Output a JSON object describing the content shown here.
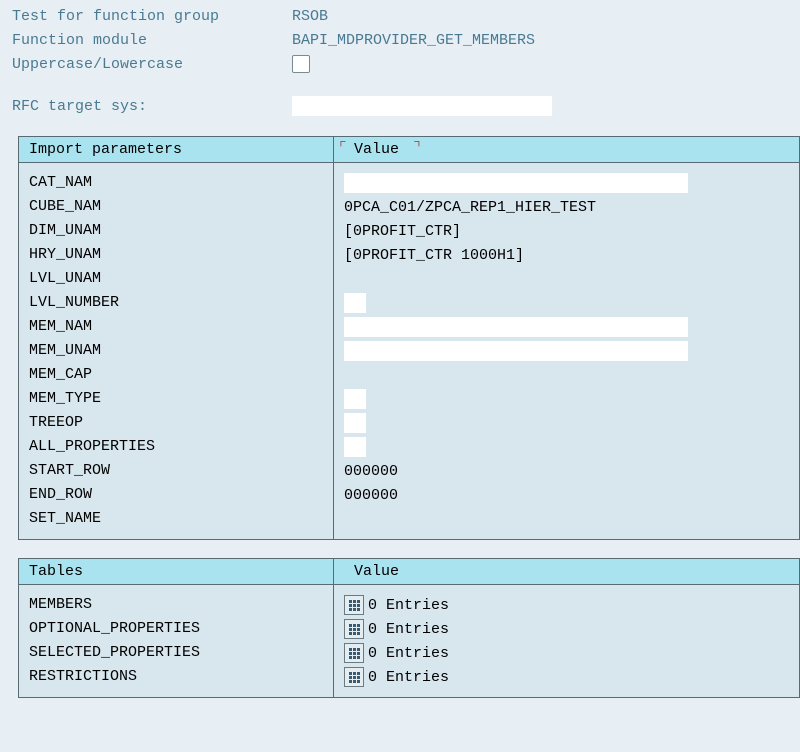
{
  "header": {
    "test_label": "Test for function group",
    "test_value": "RSOB",
    "fm_label": "Function module",
    "fm_value": "BAPI_MDPROVIDER_GET_MEMBERS",
    "case_label": "Uppercase/Lowercase",
    "rfc_label": "RFC target sys:"
  },
  "imports": {
    "col_param": "Import parameters",
    "col_value": "Value",
    "rows": [
      {
        "name": "CAT_NAM",
        "kind": "whitefield",
        "value": ""
      },
      {
        "name": "CUBE_NAM",
        "kind": "text",
        "value": "0PCA_C01/ZPCA_REP1_HIER_TEST"
      },
      {
        "name": "DIM_UNAM",
        "kind": "text",
        "value": "[0PROFIT_CTR]"
      },
      {
        "name": "HRY_UNAM",
        "kind": "text",
        "value": "[0PROFIT_CTR                     1000H1]"
      },
      {
        "name": "LVL_UNAM",
        "kind": "none",
        "value": ""
      },
      {
        "name": "LVL_NUMBER",
        "kind": "whiteshort",
        "value": ""
      },
      {
        "name": "MEM_NAM",
        "kind": "whitefield",
        "value": ""
      },
      {
        "name": "MEM_UNAM",
        "kind": "whitefield",
        "value": ""
      },
      {
        "name": "MEM_CAP",
        "kind": "none",
        "value": ""
      },
      {
        "name": "MEM_TYPE",
        "kind": "whiteshort",
        "value": ""
      },
      {
        "name": "TREEOP",
        "kind": "whiteshort",
        "value": ""
      },
      {
        "name": "ALL_PROPERTIES",
        "kind": "whiteshort",
        "value": ""
      },
      {
        "name": "START_ROW",
        "kind": "text",
        "value": "000000"
      },
      {
        "name": "END_ROW",
        "kind": "text",
        "value": "000000"
      },
      {
        "name": "SET_NAME",
        "kind": "none",
        "value": ""
      }
    ]
  },
  "tables": {
    "col_param": "Tables",
    "col_value": "Value",
    "rows": [
      {
        "name": "MEMBERS",
        "value": "0 Entries"
      },
      {
        "name": "OPTIONAL_PROPERTIES",
        "value": "0 Entries"
      },
      {
        "name": "SELECTED_PROPERTIES",
        "value": "0 Entries"
      },
      {
        "name": "RESTRICTIONS",
        "value": "0 Entries"
      }
    ]
  }
}
